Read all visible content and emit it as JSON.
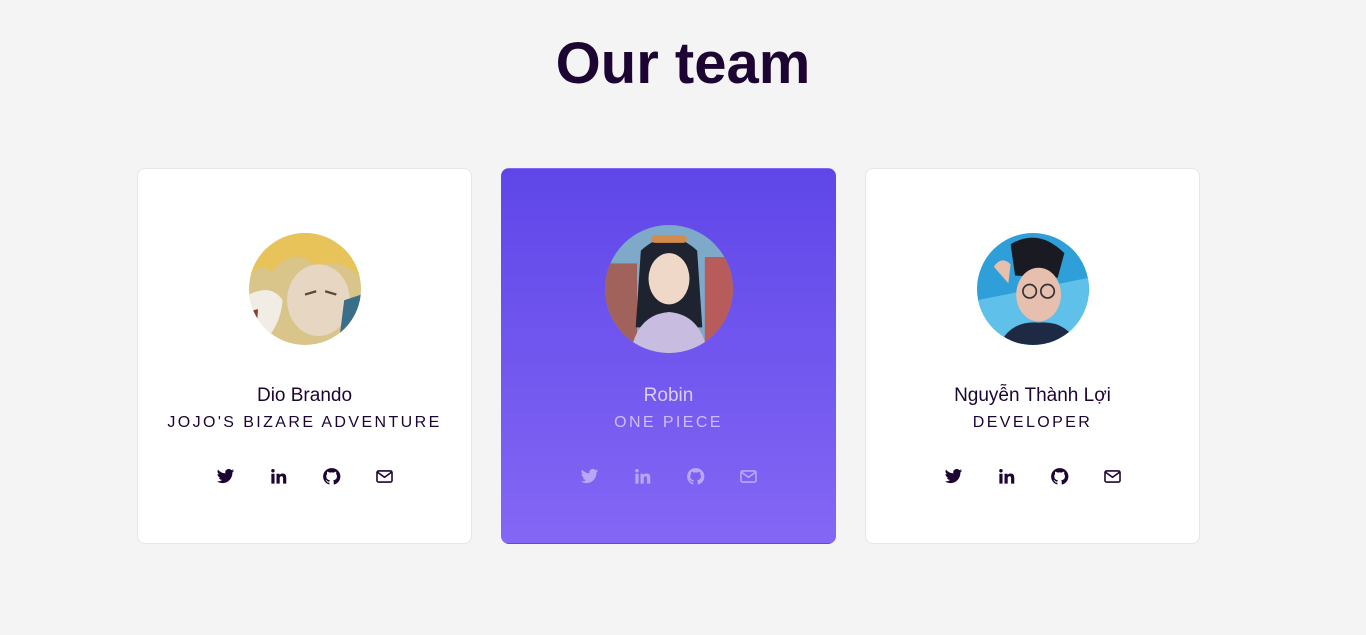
{
  "page": {
    "title": "Our team"
  },
  "colors": {
    "title": "#1c0533",
    "active_card_top": "#5f46e8",
    "active_card_bottom": "#8467f5",
    "background": "#f4f4f5"
  },
  "members": [
    {
      "name": "Dio Brando",
      "role": "JOJO'S BIZARE ADVENTURE",
      "active": false,
      "socials": [
        "twitter-icon",
        "linkedin-icon",
        "github-icon",
        "mail-icon"
      ]
    },
    {
      "name": "Robin",
      "role": "ONE PIECE",
      "active": true,
      "socials": [
        "twitter-icon",
        "linkedin-icon",
        "github-icon",
        "mail-icon"
      ]
    },
    {
      "name": "Nguyễn Thành Lợi",
      "role": "DEVELOPER",
      "active": false,
      "socials": [
        "twitter-icon",
        "linkedin-icon",
        "github-icon",
        "mail-icon"
      ]
    }
  ]
}
